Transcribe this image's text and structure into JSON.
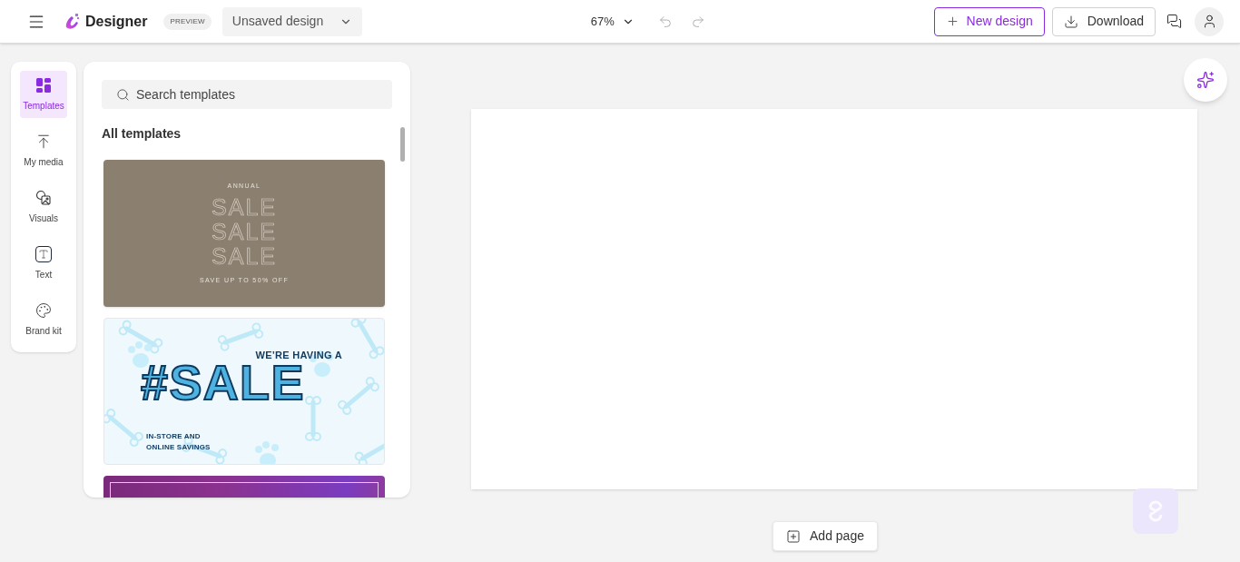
{
  "header": {
    "app_name": "Designer",
    "badge": "PREVIEW",
    "design_name": "Unsaved design",
    "zoom": "67%",
    "undo": {
      "disabled": true
    },
    "redo": {
      "disabled": true
    },
    "new_design": "New design",
    "download": "Download"
  },
  "rail": [
    {
      "kind": "templates",
      "label": "Templates",
      "selected": true
    },
    {
      "kind": "media",
      "label": "My media",
      "selected": false
    },
    {
      "kind": "visuals",
      "label": "Visuals",
      "selected": false
    },
    {
      "kind": "text",
      "label": "Text",
      "selected": false
    },
    {
      "kind": "brand",
      "label": "Brand kit",
      "selected": false
    }
  ],
  "panel": {
    "search": {
      "placeholder": "Search templates"
    },
    "heading": "All templates",
    "templates": [
      {
        "kind": "outline-sale",
        "kicker": "ANNUAL",
        "lines": [
          "SALE",
          "SALE",
          "SALE"
        ],
        "footer": "SAVE UP TO 50% OFF"
      },
      {
        "kind": "pet-sale",
        "kicker": "WE’RE HAVING A",
        "headline": "#SALE",
        "footer_lines": [
          "IN-STORE AND",
          "ONLINE SAVINGS"
        ]
      },
      {
        "kind": "gradient-frame"
      }
    ]
  },
  "canvas": {
    "add_page": "Add page"
  }
}
